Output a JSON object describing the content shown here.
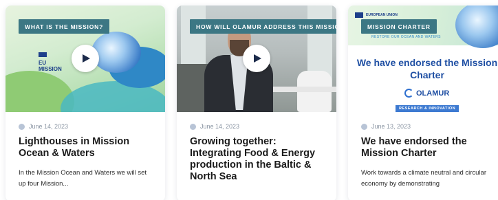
{
  "cards": [
    {
      "tag": "WHAT IS THE MISSION?",
      "date": "June 14, 2023",
      "title": "Lighthouses in Mission Ocean & Waters",
      "excerpt": "In the Mission Ocean and Waters we will set up four Mission...",
      "has_video": true,
      "thumb_text": {
        "logo_line1": "EU",
        "logo_line2": "MISSION"
      }
    },
    {
      "tag": "HOW WILL OLAMUR ADDRESS THIS MISSION?",
      "date": "June 14, 2023",
      "title": "Growing together: Integrating Food & Energy production in the Baltic & North Sea",
      "excerpt": "",
      "has_video": true
    },
    {
      "tag": "MISSION CHARTER",
      "date": "June 13, 2023",
      "title": "We have endorsed the Mission Charter",
      "excerpt": "Work towards a climate neutral and circular economy by demonstrating",
      "has_video": false,
      "thumb_text": {
        "eu_label": "EUROPEAN UNION",
        "restore_label": "RESTORE OUR OCEAN AND WATERS",
        "headline": "We have endorsed the Mission Charter",
        "olamur": "OLAMUR",
        "ri_label": "RESEARCH & INNOVATION"
      }
    }
  ],
  "icons": {
    "date": "calendar-dot-icon",
    "play": "play-icon",
    "flag": "eu-flag-icon"
  },
  "colors": {
    "tag_bg": "#3c7784",
    "title": "#1a1a1a",
    "date": "#8a95a3",
    "charter_blue": "#1f4fa3"
  }
}
